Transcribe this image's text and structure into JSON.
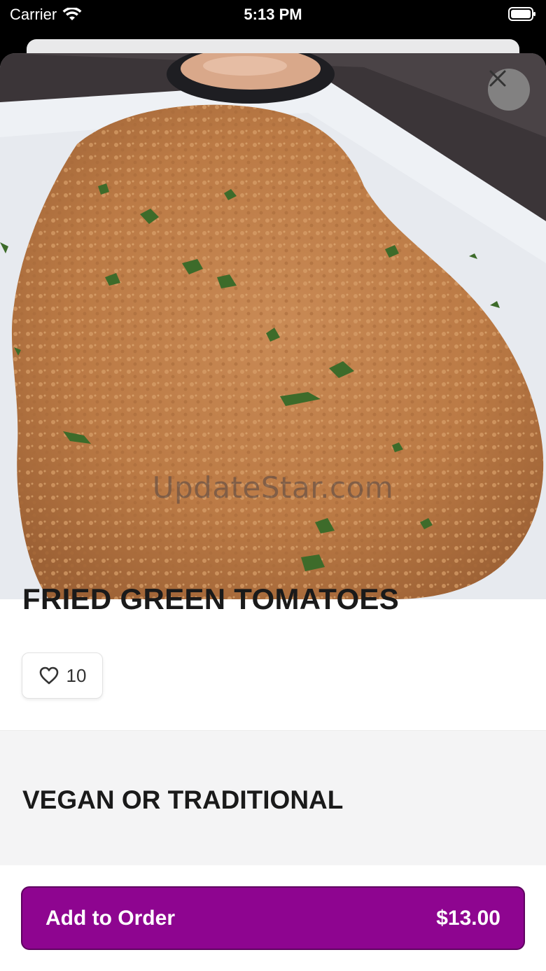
{
  "status_bar": {
    "carrier": "Carrier",
    "time": "5:13 PM"
  },
  "hero": {
    "watermark": "UpdateStar.com"
  },
  "item": {
    "title": "FRIED GREEN TOMATOES",
    "likes": "10"
  },
  "options": {
    "section_title": "VEGAN OR TRADITIONAL"
  },
  "order": {
    "label": "Add to Order",
    "price": "$13.00"
  },
  "colors": {
    "accent": "#8e0590"
  },
  "icons": {
    "close": "close-icon",
    "heart": "heart-icon",
    "wifi": "wifi-icon",
    "battery": "battery-icon"
  }
}
